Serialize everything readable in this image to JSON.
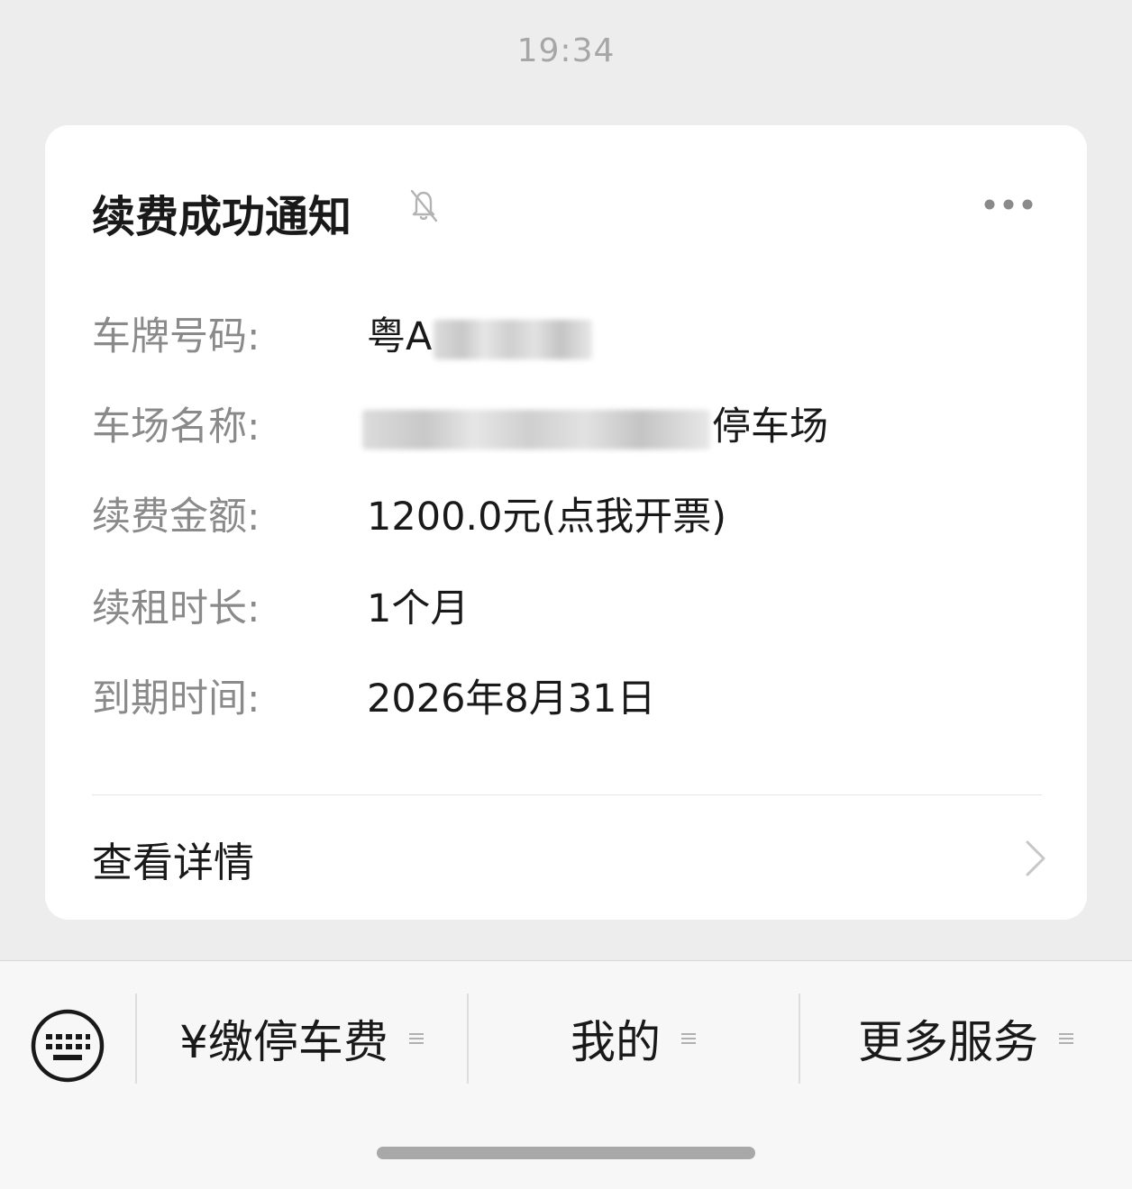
{
  "timestamp": "19:34",
  "card": {
    "title": "续费成功通知",
    "fields": [
      {
        "label": "车牌号码:",
        "value_prefix": "粤A",
        "value_suffix": ""
      },
      {
        "label": "车场名称:",
        "value_prefix": "",
        "value_suffix": "停车场"
      },
      {
        "label": "续费金额:",
        "value_prefix": "1200.0元(点我开票)",
        "value_suffix": ""
      },
      {
        "label": "续租时长:",
        "value_prefix": "1个月",
        "value_suffix": ""
      },
      {
        "label": "到期时间:",
        "value_prefix": "2026年8月31日",
        "value_suffix": ""
      }
    ],
    "detail_link": "查看详情"
  },
  "menu": {
    "items": [
      {
        "label": "¥缴停车费"
      },
      {
        "label": "我的"
      },
      {
        "label": "更多服务"
      }
    ]
  },
  "icons": {
    "mute": "bell-slash-icon",
    "more": "more-dots-icon",
    "chevron": "chevron-right-icon",
    "keyboard": "keyboard-icon",
    "menu_lines": "menu-lines-icon"
  }
}
